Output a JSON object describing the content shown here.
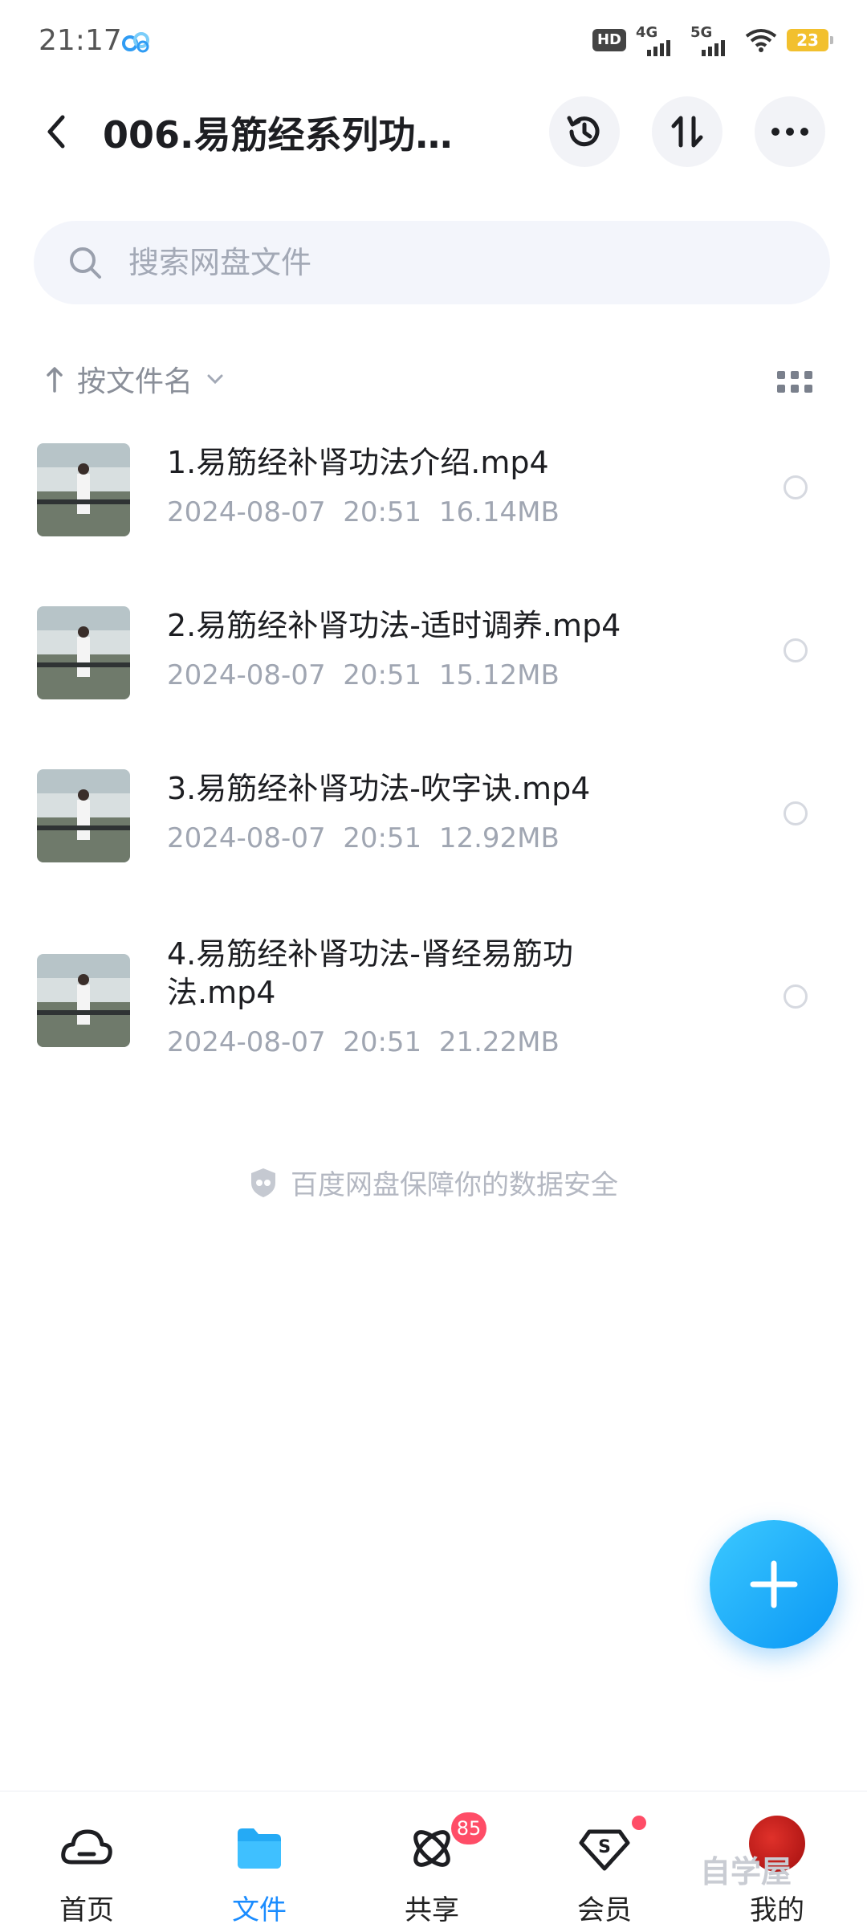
{
  "status_bar": {
    "time": "21:17",
    "network_1": "4G",
    "network_2": "5G",
    "battery": "23"
  },
  "header": {
    "title": "006.易筋经系列功…",
    "back_icon": "back-arrow-icon",
    "history_icon": "history-clock-icon",
    "sort_icon": "transfer-arrows-icon",
    "more_icon": "more-dots-icon"
  },
  "search": {
    "placeholder": "搜索网盘文件"
  },
  "sort": {
    "label": "按文件名"
  },
  "files": [
    {
      "name": "1.易筋经补肾功法介绍.mp4",
      "date": "2024-08-07  20:51",
      "size": "16.14MB"
    },
    {
      "name": "2.易筋经补肾功法-适时调养.mp4",
      "date": "2024-08-07  20:51",
      "size": "15.12MB"
    },
    {
      "name": "3.易筋经补肾功法-吹字诀.mp4",
      "date": "2024-08-07  20:51",
      "size": "12.92MB"
    },
    {
      "name": "4.易筋经补肾功法-肾经易筋功法.mp4",
      "date": "2024-08-07  20:51",
      "size": "21.22MB"
    }
  ],
  "safety_notice": "百度网盘保障你的数据安全",
  "bottom_nav": [
    {
      "label": "首页",
      "icon": "home-cloud-icon"
    },
    {
      "label": "文件",
      "icon": "folder-icon",
      "active": true
    },
    {
      "label": "共享",
      "icon": "share-orbit-icon",
      "badge": "85"
    },
    {
      "label": "会员",
      "icon": "vip-diamond-icon"
    },
    {
      "label": "我的",
      "icon": "avatar-icon"
    }
  ],
  "watermark": "自学屋",
  "colors": {
    "accent": "#1a8cff",
    "fab": "#0a97f5",
    "badge": "#ff4d67"
  }
}
